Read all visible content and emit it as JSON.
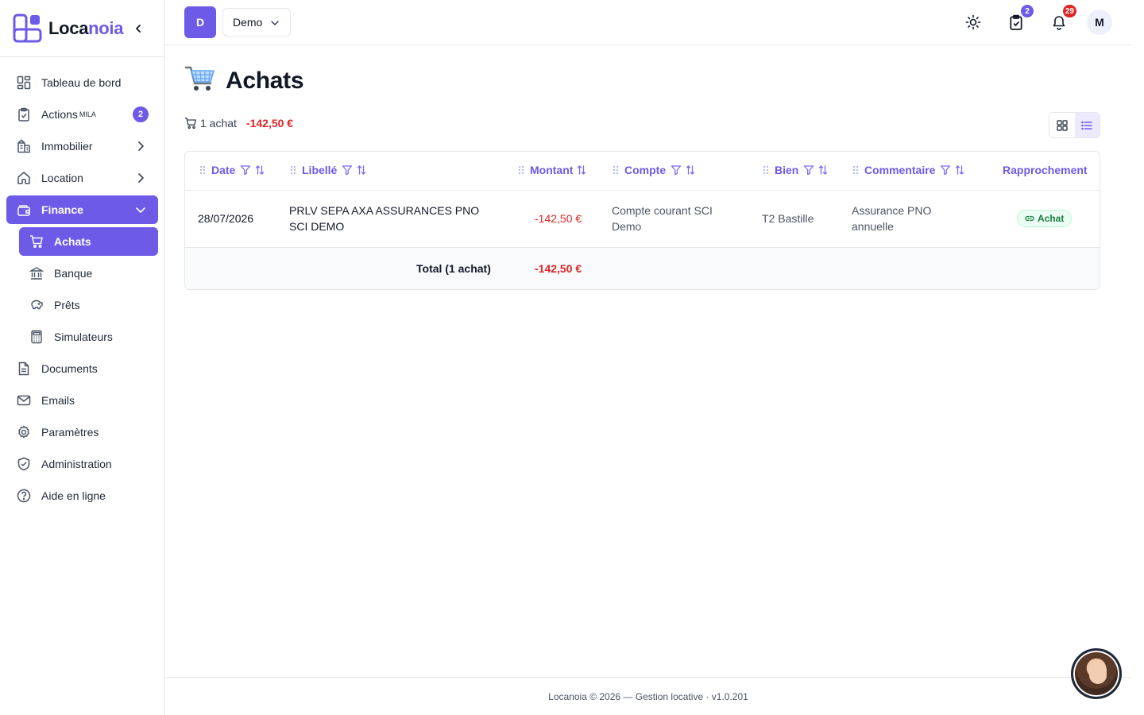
{
  "brand": {
    "name_part1": "Loca",
    "name_part2": "noia",
    "accent_color": "#6d5ae6"
  },
  "sidebar": {
    "items": [
      {
        "label": "Tableau de bord",
        "icon": "dashboard-icon"
      },
      {
        "label": "Actions",
        "sup": "MILA",
        "badge": "2",
        "icon": "clipboard-check-icon"
      },
      {
        "label": "Immobilier",
        "icon": "building-icon"
      },
      {
        "label": "Location",
        "icon": "home-icon"
      },
      {
        "label": "Finance",
        "icon": "wallet-icon",
        "expanded": true
      },
      {
        "label": "Achats",
        "icon": "cart-icon",
        "active": true
      },
      {
        "label": "Banque",
        "icon": "bank-icon"
      },
      {
        "label": "Prêts",
        "icon": "piggy-bank-icon"
      },
      {
        "label": "Simulateurs",
        "icon": "calculator-icon"
      },
      {
        "label": "Documents",
        "icon": "document-icon"
      },
      {
        "label": "Emails",
        "icon": "mail-icon"
      },
      {
        "label": "Paramètres",
        "icon": "gear-icon"
      },
      {
        "label": "Administration",
        "icon": "shield-check-icon"
      },
      {
        "label": "Aide en ligne",
        "icon": "help-circle-icon"
      }
    ]
  },
  "topbar": {
    "workspace_initial": "D",
    "workspace_name": "Demo",
    "tasks_badge": "2",
    "notifications_badge": "29",
    "user_initial": "M",
    "badge_colors": {
      "tasks": "#6d5ae6",
      "notifications": "#dc2626"
    }
  },
  "page": {
    "title": "Achats",
    "summary_count": "1 achat",
    "summary_amount": "-142,50 €"
  },
  "table": {
    "columns": [
      "Date",
      "Libellé",
      "Montant",
      "Compte",
      "Bien",
      "Commentaire",
      "Rapprochement"
    ],
    "rows": [
      {
        "date": "28/07/2026",
        "libelle_line1": "PRLV SEPA AXA ASSURANCES PNO",
        "libelle_line2": "SCI DEMO",
        "montant": "-142,50 €",
        "compte_line1": "Compte courant SCI",
        "compte_line2": "Demo",
        "bien": "T2 Bastille",
        "commentaire_line1": "Assurance PNO",
        "commentaire_line2": "annuelle",
        "rapprochement": "Achat"
      }
    ],
    "total_label": "Total (1 achat)",
    "total_amount": "-142,50 €"
  },
  "footer": {
    "text": "Locanoia © 2026 — Gestion locative · v1.0.201"
  }
}
